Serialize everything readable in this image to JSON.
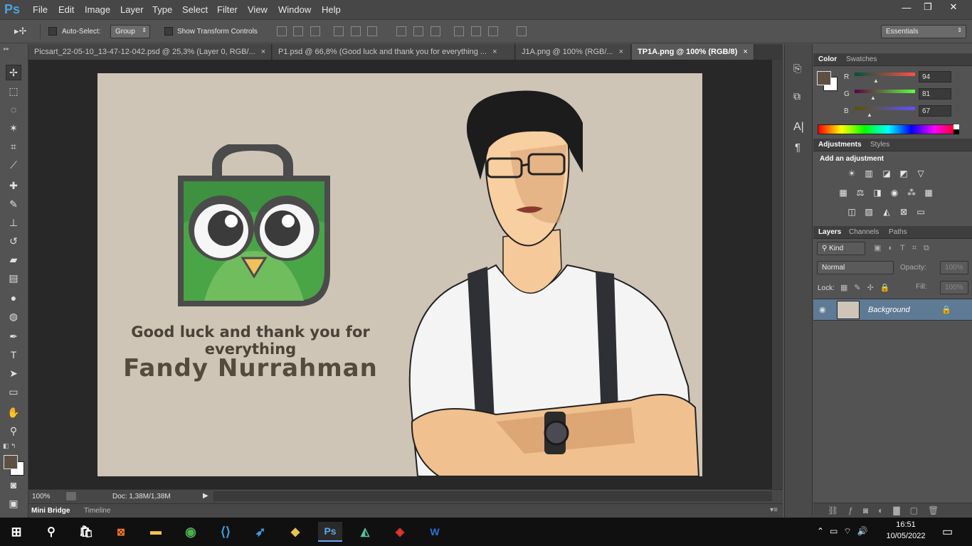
{
  "app": {
    "logo": "Ps"
  },
  "menu": [
    "File",
    "Edit",
    "Image",
    "Layer",
    "Type",
    "Select",
    "Filter",
    "View",
    "Window",
    "Help"
  ],
  "window_controls": {
    "minimize": "—",
    "restore": "❐",
    "close": "✕"
  },
  "options": {
    "auto_select_label": "Auto-Select:",
    "auto_select_value": "Group",
    "show_transform_label": "Show Transform Controls",
    "workspace": "Essentials"
  },
  "tabs": [
    {
      "label": "Picsart_22-05-10_13-47-12-042.psd @ 25,3% (Layer 0, RGB/...",
      "close": "×"
    },
    {
      "label": "P1.psd @ 66,8% (Good luck and thank you for everything ...",
      "close": "×"
    },
    {
      "label": "J1A.png @ 100% (RGB/...",
      "close": "×"
    },
    {
      "label": "TP1A.png @ 100% (RGB/8)",
      "close": "×"
    }
  ],
  "canvas": {
    "line1": "Good luck and thank you for everything",
    "line2": "Fandy Nurrahman"
  },
  "status": {
    "zoom": "100%",
    "doc": "Doc: 1,38M/1,38M"
  },
  "bottom_tabs": {
    "mini_bridge": "Mini Bridge",
    "timeline": "Timeline"
  },
  "color_panel": {
    "tabs": [
      "Color",
      "Swatches"
    ],
    "r_label": "R",
    "g_label": "G",
    "b_label": "B",
    "r": "94",
    "g": "81",
    "b": "67",
    "foreground": "#5e5143"
  },
  "adjustments_panel": {
    "tabs": [
      "Adjustments",
      "Styles"
    ],
    "heading": "Add an adjustment"
  },
  "layers_panel": {
    "tabs": [
      "Layers",
      "Channels",
      "Paths"
    ],
    "kind": "Kind",
    "blend_mode": "Normal",
    "opacity_label": "Opacity:",
    "opacity": "100%",
    "lock_label": "Lock:",
    "fill_label": "Fill:",
    "fill": "100%",
    "layers": [
      {
        "name": "Background"
      }
    ]
  },
  "taskbar": {
    "time": "16:51",
    "date": "10/05/2022"
  }
}
